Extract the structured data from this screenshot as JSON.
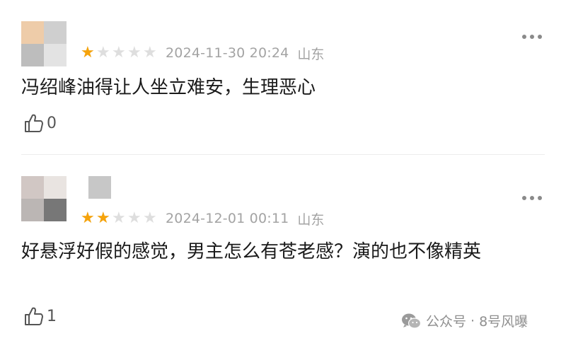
{
  "reviews": [
    {
      "avatar_colors": [
        "#eecca9",
        "#cfcfcf",
        "#bdbdbd",
        "#e3e3e3"
      ],
      "rating": 1,
      "date": "2024-11-30 20:24",
      "location": "山东",
      "content": "冯绍峰油得让人坐立难安，生理恶心",
      "likes": "0"
    },
    {
      "avatar_colors": [
        "#d1c7c4",
        "#e9e4e1",
        "#bbb6b4",
        "#777777"
      ],
      "rating": 2,
      "date": "2024-12-01 00:11",
      "location": "山东",
      "content": "好悬浮好假的感觉，男主怎么有苍老感？演的也不像精英",
      "likes": "1"
    }
  ],
  "watermark": {
    "icon": "wechat-icon",
    "account_label": "公众号",
    "separator": "·",
    "account_name": "8号风曝"
  },
  "colors": {
    "star_active": "#f6a30a",
    "star_inactive": "#dedede",
    "meta_text": "#a3a3a3"
  }
}
